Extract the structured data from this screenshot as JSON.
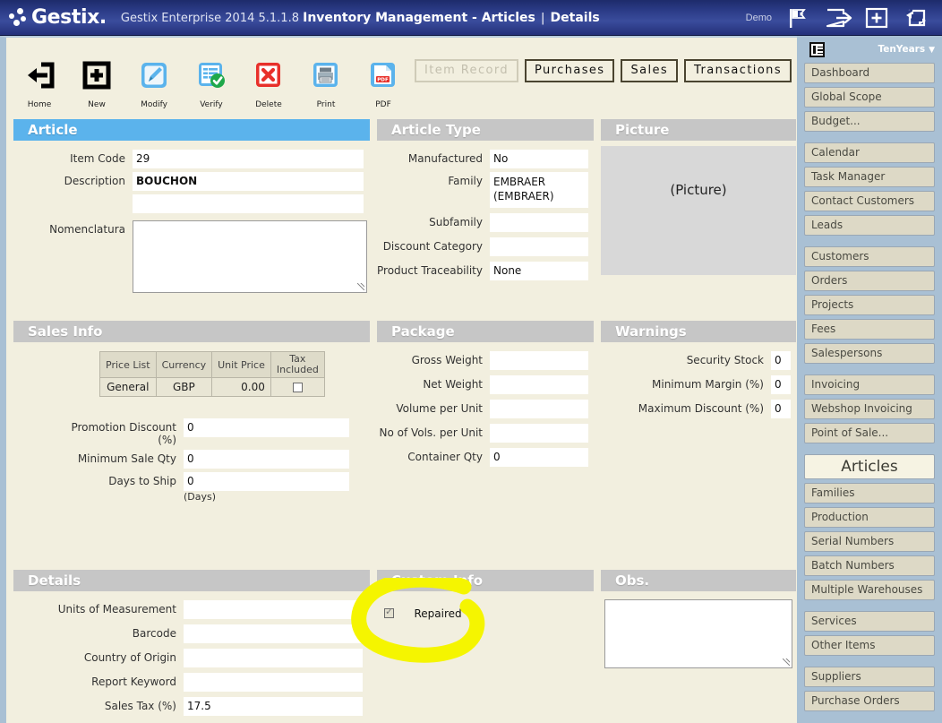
{
  "topbar": {
    "logo_text": "Gestix.",
    "title_prefix": "Gestix Enterprise 2014 5.1.1.8",
    "title_strong": "Inventory Management - Articles",
    "title_sep": "|",
    "title_suffix": "Details",
    "demo_label": "Demo",
    "icons": [
      "flag-icon",
      "logout-icon",
      "plus-box-icon",
      "refresh-icon"
    ]
  },
  "toolbar": [
    {
      "label": "Home",
      "icon": "home-back-arrow-icon"
    },
    {
      "label": "New",
      "icon": "plus-square-icon"
    },
    {
      "label": "Modify",
      "icon": "pencil-edit-icon"
    },
    {
      "label": "Verify",
      "icon": "list-check-icon"
    },
    {
      "label": "Delete",
      "icon": "red-x-icon"
    },
    {
      "label": "Print",
      "icon": "printer-icon"
    },
    {
      "label": "PDF",
      "icon": "pdf-file-icon"
    }
  ],
  "tab_buttons": [
    {
      "label": "Item Record",
      "disabled": true
    },
    {
      "label": "Purchases",
      "disabled": false
    },
    {
      "label": "Sales",
      "disabled": false
    },
    {
      "label": "Transactions",
      "disabled": false
    }
  ],
  "panels": {
    "article": {
      "title": "Article",
      "fields": {
        "item_code_label": "Item Code",
        "item_code_value": "29",
        "description_label": "Description",
        "description_value": "BOUCHON",
        "description_value2": "",
        "nomenclatura_label": "Nomenclatura",
        "nomenclatura_value": ""
      }
    },
    "article_type": {
      "title": "Article Type",
      "fields": {
        "manufactured_label": "Manufactured",
        "manufactured_value": "No",
        "family_label": "Family",
        "family_value": "EMBRAER (EMBRAER)",
        "subfamily_label": "Subfamily",
        "subfamily_value": "",
        "discount_category_label": "Discount Category",
        "discount_category_value": "",
        "product_traceability_label": "Product Traceability",
        "product_traceability_value": "None"
      }
    },
    "picture": {
      "title": "Picture",
      "placeholder": "(Picture)"
    },
    "sales_info": {
      "title": "Sales Info",
      "price_table": {
        "headers": [
          "Price List",
          "Currency",
          "Unit Price",
          "Tax Included"
        ],
        "rows": [
          {
            "price_list": "General",
            "currency": "GBP",
            "unit_price": "0.00",
            "tax_included": false
          }
        ]
      },
      "fields": {
        "promotion_discount_label": "Promotion Discount (%)",
        "promotion_discount_label_l1": "Promotion Discount",
        "promotion_discount_label_l2": "(%)",
        "promotion_discount_value": "0",
        "minimum_sale_qty_label": "Minimum Sale Qty",
        "minimum_sale_qty_value": "0",
        "days_to_ship_label": "Days to Ship",
        "days_to_ship_value": "0",
        "days_to_ship_note": "(Days)"
      }
    },
    "package": {
      "title": "Package",
      "fields": {
        "gross_weight_label": "Gross Weight",
        "gross_weight_value": "",
        "net_weight_label": "Net Weight",
        "net_weight_value": "",
        "volume_per_unit_label": "Volume per Unit",
        "volume_per_unit_value": "",
        "no_of_vols_label": "No of Vols. per Unit",
        "no_of_vols_value": "",
        "container_qty_label": "Container Qty",
        "container_qty_value": "0"
      }
    },
    "warnings": {
      "title": "Warnings",
      "fields": {
        "security_stock_label": "Security Stock",
        "security_stock_value": "0",
        "minimum_margin_label": "Minimum Margin (%)",
        "minimum_margin_value": "0",
        "maximum_discount_label": "Maximum Discount (%)",
        "maximum_discount_value": "0"
      }
    },
    "details": {
      "title": "Details",
      "fields": {
        "units_of_measurement_label": "Units of Measurement",
        "units_of_measurement_value": "",
        "barcode_label": "Barcode",
        "barcode_value": "",
        "country_of_origin_label": "Country of Origin",
        "country_of_origin_value": "",
        "report_keyword_label": "Report Keyword",
        "report_keyword_value": "",
        "sales_tax_label": "Sales Tax (%)",
        "sales_tax_value": "17.5"
      }
    },
    "custom_info": {
      "title": "Custom Info",
      "repaired_label": "Repaired",
      "repaired_checked": true
    },
    "obs": {
      "title": "Obs.",
      "value": ""
    }
  },
  "annotation": {
    "type": "yellow-highlight-circle",
    "color": "#f5f500",
    "target": "repaired-checkbox"
  },
  "sidebar": {
    "user_label": "TenYears",
    "caret": "▼",
    "groups": [
      {
        "items": [
          {
            "label": "Dashboard"
          },
          {
            "label": "Global Scope"
          },
          {
            "label": "Budget..."
          }
        ]
      },
      {
        "items": [
          {
            "label": "Calendar"
          },
          {
            "label": "Task Manager"
          },
          {
            "label": "Contact Customers"
          },
          {
            "label": "Leads"
          }
        ]
      },
      {
        "items": [
          {
            "label": "Customers"
          },
          {
            "label": "Orders"
          },
          {
            "label": "Projects"
          },
          {
            "label": "Fees"
          },
          {
            "label": "Salespersons"
          }
        ]
      },
      {
        "items": [
          {
            "label": "Invoicing"
          },
          {
            "label": "Webshop Invoicing"
          },
          {
            "label": "Point of Sale..."
          }
        ]
      },
      {
        "items": [
          {
            "label": "Articles",
            "section": true
          },
          {
            "label": "Families"
          },
          {
            "label": "Production"
          },
          {
            "label": "Serial Numbers"
          },
          {
            "label": "Batch Numbers"
          },
          {
            "label": "Multiple Warehouses"
          }
        ]
      },
      {
        "items": [
          {
            "label": "Services"
          },
          {
            "label": "Other Items"
          }
        ]
      },
      {
        "items": [
          {
            "label": "Suppliers"
          },
          {
            "label": "Purchase Orders"
          }
        ]
      }
    ]
  },
  "colors": {
    "topbar": "#2a3a85",
    "panel_header_active": "#5bb3ec",
    "panel_header": "#c6c6c6",
    "page_bg": "#f2efdf",
    "sidebar_bg": "#a9c0d4",
    "sidebar_button": "#ddd9c6",
    "highlight": "#f5f500"
  }
}
